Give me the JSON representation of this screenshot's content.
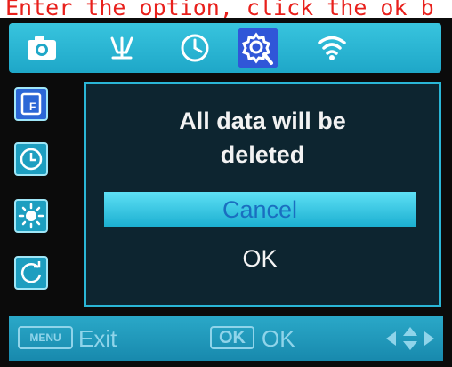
{
  "caption": "Enter the option, click the ok b",
  "top_tabs": [
    {
      "icon": "camera-icon"
    },
    {
      "icon": "antenna-icon"
    },
    {
      "icon": "clock-icon"
    },
    {
      "icon": "settings-gear-icon"
    },
    {
      "icon": "wifi-icon"
    }
  ],
  "side_items": [
    {
      "icon": "sd-card-format-icon"
    },
    {
      "icon": "time-icon"
    },
    {
      "icon": "brightness-icon"
    },
    {
      "icon": "reset-icon"
    }
  ],
  "dialog": {
    "message_line1": "All data will be",
    "message_line2": "deleted",
    "options": [
      "Cancel",
      "OK"
    ],
    "selected": "Cancel"
  },
  "bottom": {
    "menu_key": "MENU",
    "menu_action": "Exit",
    "ok_key": "OK",
    "ok_action": "OK"
  },
  "colors": {
    "accent": "#1ea7c8",
    "selected_tab": "#3056d8",
    "caption": "#e8201c"
  }
}
